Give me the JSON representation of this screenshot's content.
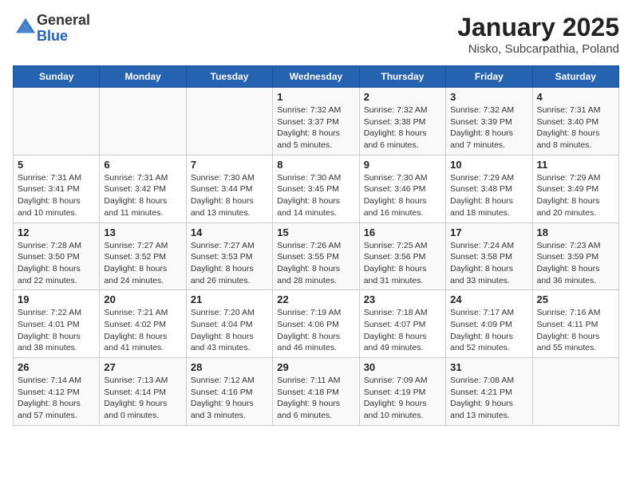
{
  "header": {
    "logo_general": "General",
    "logo_blue": "Blue",
    "title": "January 2025",
    "subtitle": "Nisko, Subcarpathia, Poland"
  },
  "days_of_week": [
    "Sunday",
    "Monday",
    "Tuesday",
    "Wednesday",
    "Thursday",
    "Friday",
    "Saturday"
  ],
  "weeks": [
    [
      {
        "day": "",
        "info": ""
      },
      {
        "day": "",
        "info": ""
      },
      {
        "day": "",
        "info": ""
      },
      {
        "day": "1",
        "info": "Sunrise: 7:32 AM\nSunset: 3:37 PM\nDaylight: 8 hours and 5 minutes."
      },
      {
        "day": "2",
        "info": "Sunrise: 7:32 AM\nSunset: 3:38 PM\nDaylight: 8 hours and 6 minutes."
      },
      {
        "day": "3",
        "info": "Sunrise: 7:32 AM\nSunset: 3:39 PM\nDaylight: 8 hours and 7 minutes."
      },
      {
        "day": "4",
        "info": "Sunrise: 7:31 AM\nSunset: 3:40 PM\nDaylight: 8 hours and 8 minutes."
      }
    ],
    [
      {
        "day": "5",
        "info": "Sunrise: 7:31 AM\nSunset: 3:41 PM\nDaylight: 8 hours and 10 minutes."
      },
      {
        "day": "6",
        "info": "Sunrise: 7:31 AM\nSunset: 3:42 PM\nDaylight: 8 hours and 11 minutes."
      },
      {
        "day": "7",
        "info": "Sunrise: 7:30 AM\nSunset: 3:44 PM\nDaylight: 8 hours and 13 minutes."
      },
      {
        "day": "8",
        "info": "Sunrise: 7:30 AM\nSunset: 3:45 PM\nDaylight: 8 hours and 14 minutes."
      },
      {
        "day": "9",
        "info": "Sunrise: 7:30 AM\nSunset: 3:46 PM\nDaylight: 8 hours and 16 minutes."
      },
      {
        "day": "10",
        "info": "Sunrise: 7:29 AM\nSunset: 3:48 PM\nDaylight: 8 hours and 18 minutes."
      },
      {
        "day": "11",
        "info": "Sunrise: 7:29 AM\nSunset: 3:49 PM\nDaylight: 8 hours and 20 minutes."
      }
    ],
    [
      {
        "day": "12",
        "info": "Sunrise: 7:28 AM\nSunset: 3:50 PM\nDaylight: 8 hours and 22 minutes."
      },
      {
        "day": "13",
        "info": "Sunrise: 7:27 AM\nSunset: 3:52 PM\nDaylight: 8 hours and 24 minutes."
      },
      {
        "day": "14",
        "info": "Sunrise: 7:27 AM\nSunset: 3:53 PM\nDaylight: 8 hours and 26 minutes."
      },
      {
        "day": "15",
        "info": "Sunrise: 7:26 AM\nSunset: 3:55 PM\nDaylight: 8 hours and 28 minutes."
      },
      {
        "day": "16",
        "info": "Sunrise: 7:25 AM\nSunset: 3:56 PM\nDaylight: 8 hours and 31 minutes."
      },
      {
        "day": "17",
        "info": "Sunrise: 7:24 AM\nSunset: 3:58 PM\nDaylight: 8 hours and 33 minutes."
      },
      {
        "day": "18",
        "info": "Sunrise: 7:23 AM\nSunset: 3:59 PM\nDaylight: 8 hours and 36 minutes."
      }
    ],
    [
      {
        "day": "19",
        "info": "Sunrise: 7:22 AM\nSunset: 4:01 PM\nDaylight: 8 hours and 38 minutes."
      },
      {
        "day": "20",
        "info": "Sunrise: 7:21 AM\nSunset: 4:02 PM\nDaylight: 8 hours and 41 minutes."
      },
      {
        "day": "21",
        "info": "Sunrise: 7:20 AM\nSunset: 4:04 PM\nDaylight: 8 hours and 43 minutes."
      },
      {
        "day": "22",
        "info": "Sunrise: 7:19 AM\nSunset: 4:06 PM\nDaylight: 8 hours and 46 minutes."
      },
      {
        "day": "23",
        "info": "Sunrise: 7:18 AM\nSunset: 4:07 PM\nDaylight: 8 hours and 49 minutes."
      },
      {
        "day": "24",
        "info": "Sunrise: 7:17 AM\nSunset: 4:09 PM\nDaylight: 8 hours and 52 minutes."
      },
      {
        "day": "25",
        "info": "Sunrise: 7:16 AM\nSunset: 4:11 PM\nDaylight: 8 hours and 55 minutes."
      }
    ],
    [
      {
        "day": "26",
        "info": "Sunrise: 7:14 AM\nSunset: 4:12 PM\nDaylight: 8 hours and 57 minutes."
      },
      {
        "day": "27",
        "info": "Sunrise: 7:13 AM\nSunset: 4:14 PM\nDaylight: 9 hours and 0 minutes."
      },
      {
        "day": "28",
        "info": "Sunrise: 7:12 AM\nSunset: 4:16 PM\nDaylight: 9 hours and 3 minutes."
      },
      {
        "day": "29",
        "info": "Sunrise: 7:11 AM\nSunset: 4:18 PM\nDaylight: 9 hours and 6 minutes."
      },
      {
        "day": "30",
        "info": "Sunrise: 7:09 AM\nSunset: 4:19 PM\nDaylight: 9 hours and 10 minutes."
      },
      {
        "day": "31",
        "info": "Sunrise: 7:08 AM\nSunset: 4:21 PM\nDaylight: 9 hours and 13 minutes."
      },
      {
        "day": "",
        "info": ""
      }
    ]
  ]
}
